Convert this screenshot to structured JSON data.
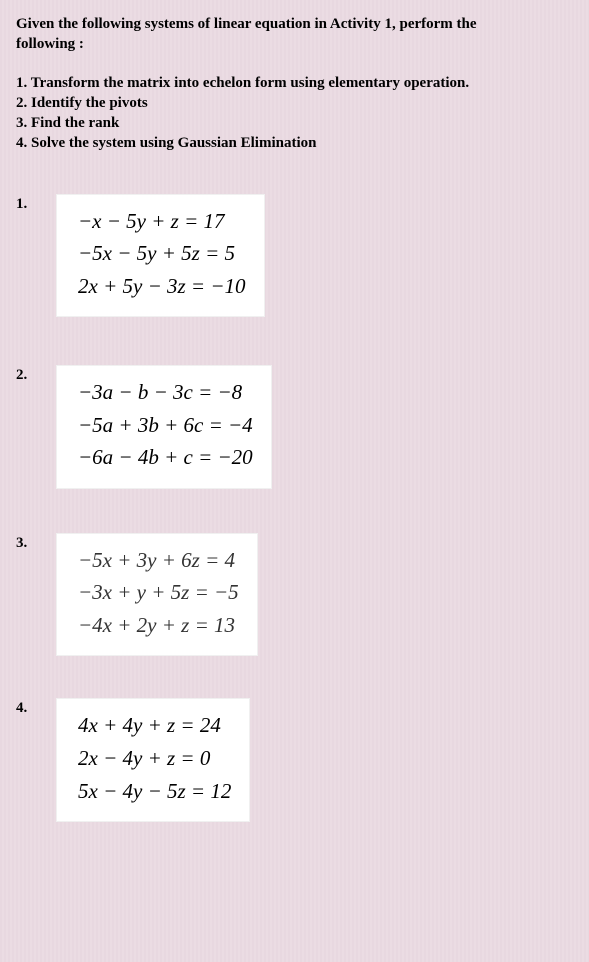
{
  "intro": {
    "line1": "Given the following  systems of linear equation in Activity 1, perform  the",
    "line2": "following :"
  },
  "instructions": {
    "i1": "1.   Transform the matrix into echelon form using elementary operation.",
    "i2": "2.   Identify the pivots",
    "i3": "3.   Find the rank",
    "i4": "4.   Solve the system using Gaussian Elimination"
  },
  "problems": {
    "p1": {
      "number": "1.",
      "eq1": "−x − 5y + z = 17",
      "eq2": "−5x − 5y + 5z = 5",
      "eq3": "2x + 5y − 3z = −10"
    },
    "p2": {
      "number": "2.",
      "eq1": "−3a − b − 3c = −8",
      "eq2": "−5a + 3b + 6c = −4",
      "eq3": "−6a − 4b + c = −20"
    },
    "p3": {
      "number": "3.",
      "eq1": "−5x + 3y + 6z = 4",
      "eq2": "−3x + y + 5z = −5",
      "eq3": "−4x + 2y + z = 13"
    },
    "p4": {
      "number": "4.",
      "eq1": "4x + 4y + z = 24",
      "eq2": "2x − 4y + z = 0",
      "eq3": "5x − 4y − 5z = 12"
    }
  }
}
